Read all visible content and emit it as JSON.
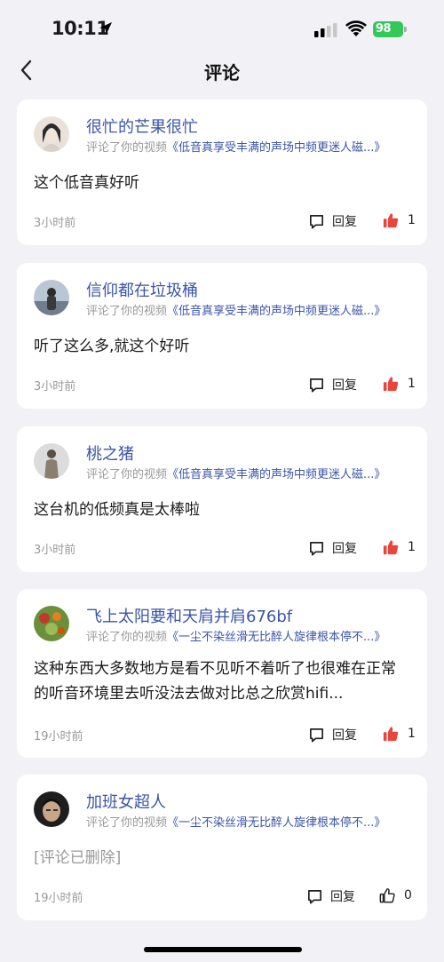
{
  "status_bar": {
    "time": "10:11",
    "battery": "98"
  },
  "nav": {
    "title": "评论"
  },
  "comments": [
    {
      "user": "很忙的芒果很忙",
      "action": "评论了你的视频",
      "video": "《低音真享受丰满的声场中频更迷人磁...》",
      "text": "这个低音真好听",
      "time": "3小时前",
      "reply_label": "回复",
      "likes": "1",
      "liked": true,
      "deleted": false
    },
    {
      "user": "信仰都在垃圾桶",
      "action": "评论了你的视频",
      "video": "《低音真享受丰满的声场中频更迷人磁...》",
      "text": "听了这么多,就这个好听",
      "time": "3小时前",
      "reply_label": "回复",
      "likes": "1",
      "liked": true,
      "deleted": false
    },
    {
      "user": "桃之猪",
      "action": "评论了你的视频",
      "video": "《低音真享受丰满的声场中频更迷人磁...》",
      "text": "这台机的低频真是太棒啦",
      "time": "3小时前",
      "reply_label": "回复",
      "likes": "1",
      "liked": true,
      "deleted": false
    },
    {
      "user": "飞上太阳要和天肩并肩676bf",
      "action": "评论了你的视频",
      "video": "《一尘不染丝滑无比醉人旋律根本停不...》",
      "text": "这种东西大多数地方是看不见听不着听了也很难在正常的听音环境里去听没法去做对比总之欣赏hifi...",
      "time": "19小时前",
      "reply_label": "回复",
      "likes": "1",
      "liked": true,
      "deleted": false
    },
    {
      "user": "加班女超人",
      "action": "评论了你的视频",
      "video": "《一尘不染丝滑无比醉人旋律根本停不...》",
      "text": "[评论已删除]",
      "time": "19小时前",
      "reply_label": "回复",
      "likes": "0",
      "liked": false,
      "deleted": true
    }
  ],
  "colors": {
    "accent": "#3a55a8",
    "like_red": "#e8453c",
    "battery_green": "#34c759"
  }
}
